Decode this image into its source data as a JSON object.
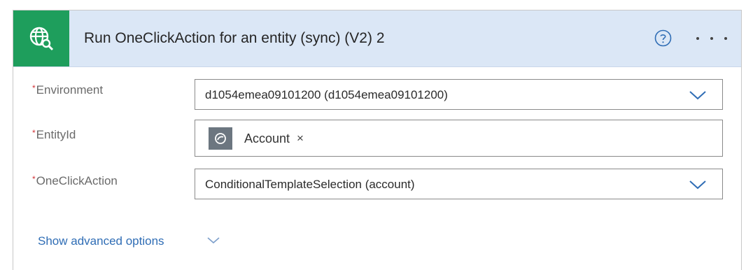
{
  "header": {
    "title": "Run OneClickAction for an entity (sync) (V2) 2",
    "icon": "globe-search-icon",
    "help_icon": "help-circle-icon",
    "more_icon": "more-dots-icon"
  },
  "form": {
    "required_mark": "*",
    "fields": [
      {
        "label": "Environment",
        "value": "d1054emea09101200 (d1054emea09101200)"
      },
      {
        "label": "EntityId",
        "token": "Account",
        "token_remove": "×"
      },
      {
        "label": "OneClickAction",
        "value": "ConditionalTemplateSelection (account)"
      }
    ],
    "advanced_link": "Show advanced options"
  },
  "colors": {
    "header_bg": "#dbe7f6",
    "icon_bg": "#1e9e5c",
    "link": "#2f6db5",
    "required": "#d13438"
  }
}
